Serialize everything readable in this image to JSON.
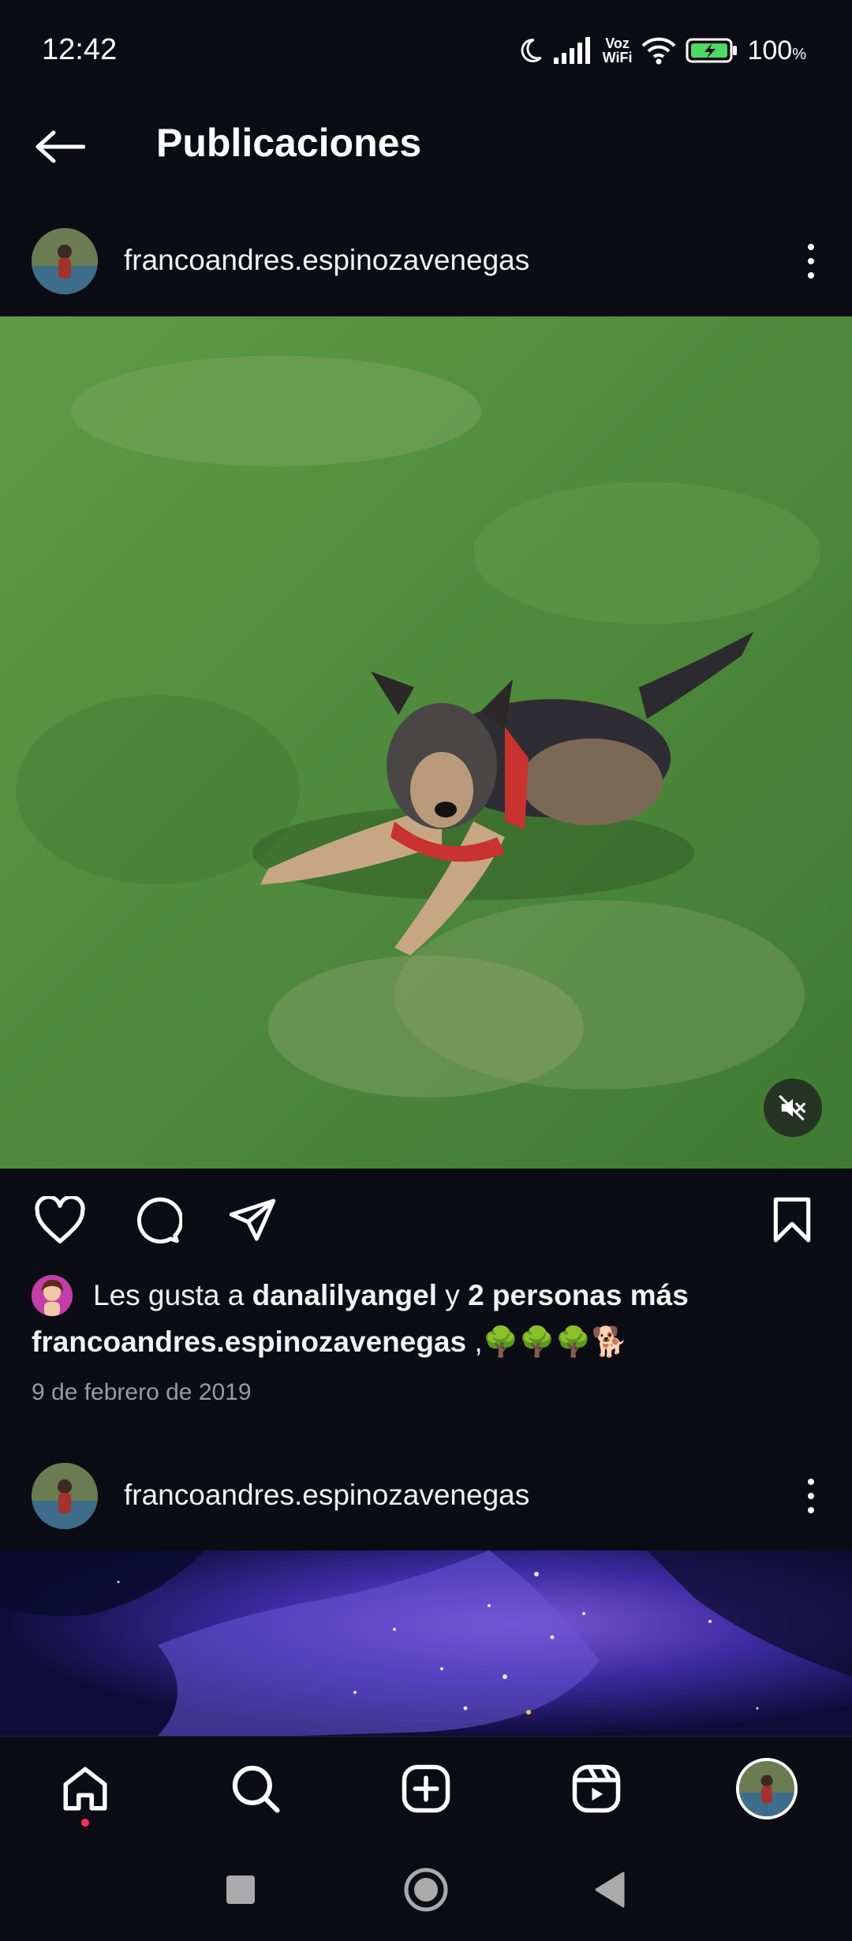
{
  "status_bar": {
    "time": "12:42",
    "voz": "Voz",
    "wifi": "WiFi",
    "battery_percent": "100",
    "battery_unit": "%"
  },
  "header": {
    "title": "Publicaciones"
  },
  "post1": {
    "username": "francoandres.espinozavenegas",
    "likes_prefix": "Les gusta a ",
    "liked_by": "danalilyangel",
    "likes_connector": " y ",
    "likes_others": "2 personas más",
    "caption_user": "francoandres.espinozavenegas",
    "caption_text": " ,🌳🌳🌳🐕",
    "date": "9 de febrero de 2019"
  },
  "post2": {
    "username": "francoandres.espinozavenegas"
  },
  "colors": {
    "background": "#0c0c14",
    "notification_dot": "#ff2d55",
    "battery_green": "#4cd964"
  },
  "icons": {
    "header": [
      "back-arrow-icon"
    ],
    "actions": [
      "heart-icon",
      "comment-icon",
      "share-icon",
      "bookmark-icon"
    ],
    "bottom_nav": [
      "home-icon",
      "search-icon",
      "create-icon",
      "reels-icon",
      "profile-avatar"
    ],
    "system_nav": [
      "recents-icon",
      "home-circle-icon",
      "back-triangle-icon"
    ]
  }
}
